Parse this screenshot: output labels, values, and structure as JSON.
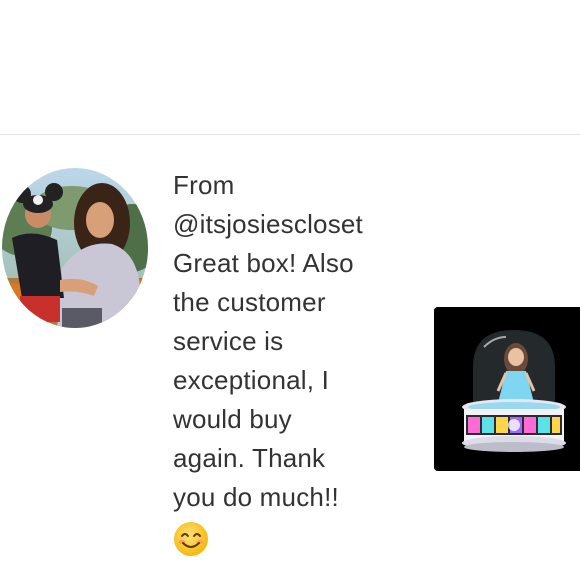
{
  "comment": {
    "from_label": "From",
    "username": "@itsjosiescloset",
    "lines": [
      "Great box! Also",
      "the customer",
      "service is",
      "exceptional, I",
      "would buy",
      "again. Thank",
      "you do much!!"
    ],
    "emoji": "smiling-face-emoji"
  },
  "avatar": {
    "icon": "user-avatar-photo"
  },
  "product": {
    "icon": "doll-snow-globe-thumbnail"
  }
}
